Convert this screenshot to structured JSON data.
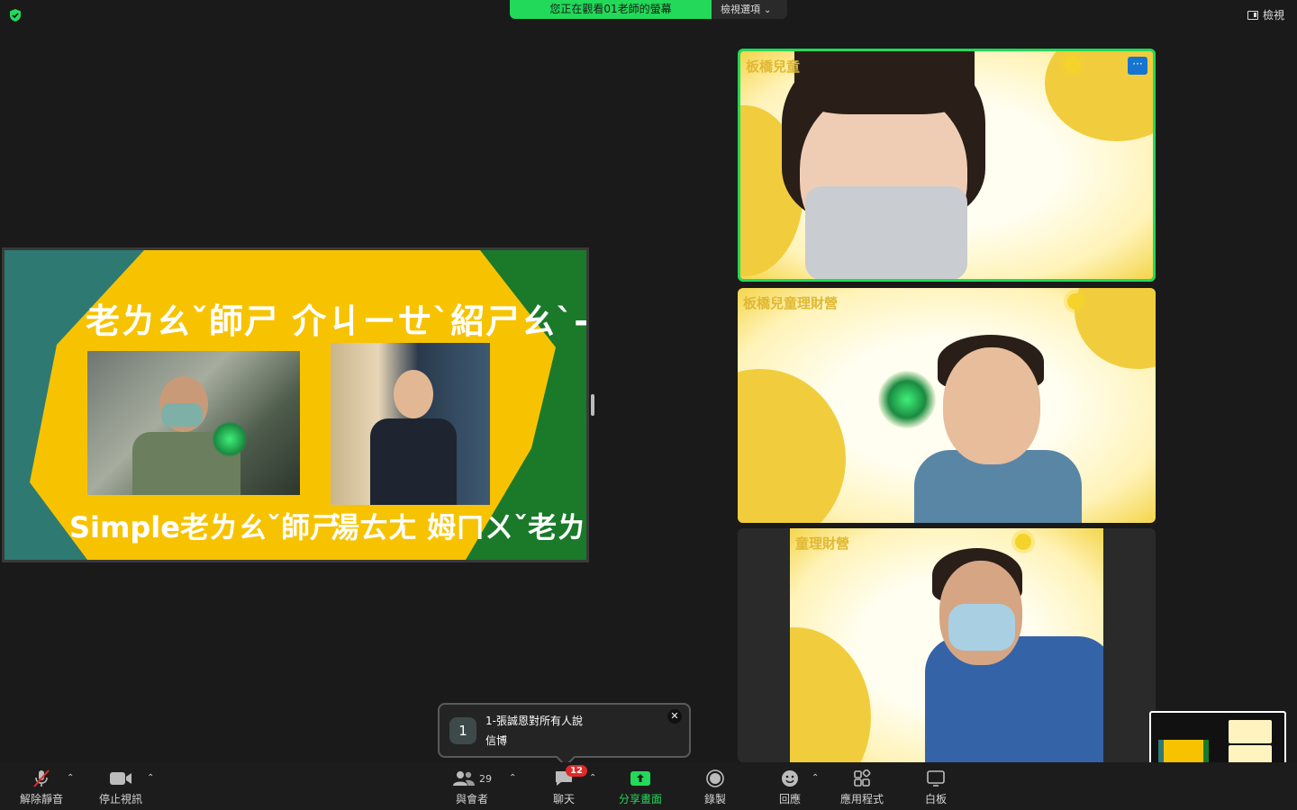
{
  "top_bar": {
    "viewing_banner": "您正在觀看01老師的螢幕",
    "view_options_label": "檢視選項",
    "view_button_label": "檢視"
  },
  "shared_screen": {
    "title": "老ㄌㄠˇ師ㄕ 介ㄐㄧㄝˋ紹ㄕㄠˋ-什ㄕㄣˊ一ㄧ 課ㄎㄜˋ",
    "caption_left": "Simple老ㄌㄠˇ師ㄕ",
    "caption_right": "湯ㄊㄤ 姆ㄇㄨˇ老ㄌㄠˇ師ㄕ"
  },
  "tiles": [
    {
      "label": "板橋兒童",
      "more": "···"
    },
    {
      "label": "板橋兒童理財營"
    },
    {
      "label": "童理財營"
    }
  ],
  "chat_toast": {
    "count": "1",
    "sender": "1-張誠恩對所有人說",
    "message": "信博",
    "close": "✕"
  },
  "toolbar": {
    "unmute": "解除靜音",
    "stop_video": "停止視訊",
    "participants": "與會者",
    "participants_count": "29",
    "chat": "聊天",
    "chat_badge": "12",
    "share_screen": "分享畫面",
    "record": "錄製",
    "reactions": "回應",
    "apps": "應用程式",
    "whiteboard": "白板"
  },
  "colors": {
    "accent_green": "#23d959",
    "background": "#1a1a1a",
    "toolbar": "#1c1c1c",
    "badge_red": "#e02828",
    "slide_yellow": "#f7c300",
    "slide_teal": "#2e7a73",
    "slide_green": "#1a7a2a"
  }
}
